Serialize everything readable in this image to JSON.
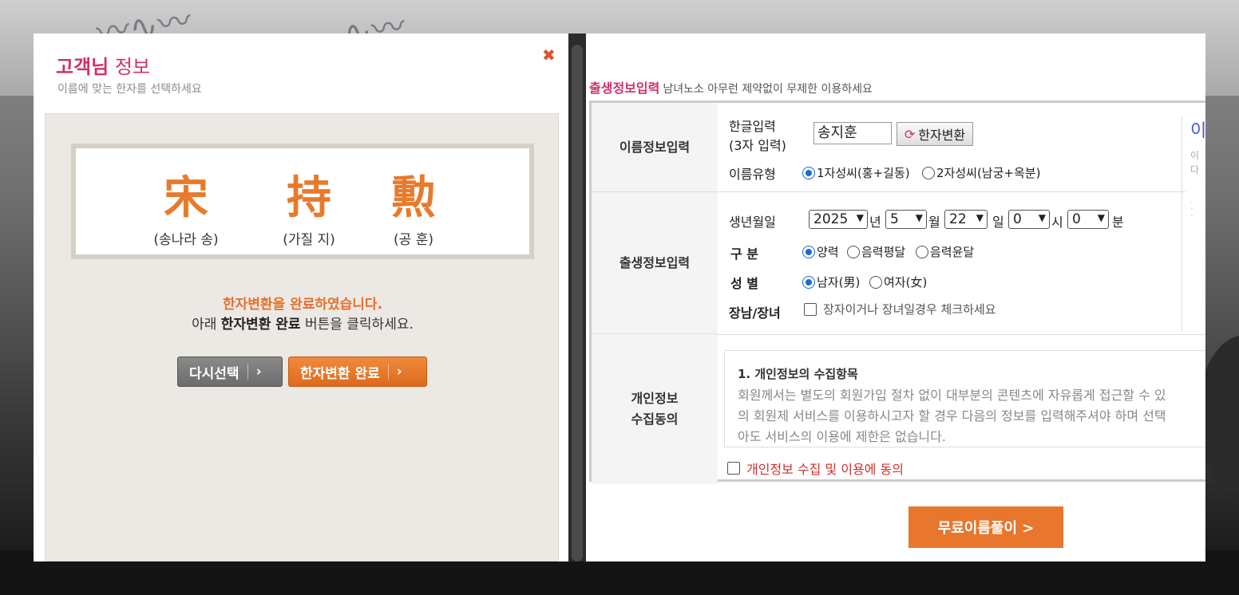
{
  "left_modal": {
    "title_bold": "고객님",
    "title_rest": " 정보",
    "subtitle": "이름에 맞는 한자를 선택하세요",
    "close_icon": "close-icon",
    "hanja": [
      {
        "char": "宋",
        "reading": "(송나라 송)"
      },
      {
        "char": "持",
        "reading": "(가질 지)"
      },
      {
        "char": "勲",
        "reading": "(공 훈)"
      }
    ],
    "message_done": "한자변환을 완료하였습니다.",
    "message_prefix": "아래 ",
    "message_bold": "한자변환 완료",
    "message_suffix": " 버튼을 클릭하세요.",
    "reselect_label": "다시선택",
    "complete_label": "한자변환 완료",
    "arrow": "›"
  },
  "right_page": {
    "header_title": "출생정보입력",
    "header_sub": "남녀노소 아무런 제약없이 무제한 이용하세요",
    "name_section": {
      "label": "이름정보입력",
      "korean_input_label_1": "한글입력",
      "korean_input_label_2": "(3자 입력)",
      "name_value": "송지훈",
      "hanja_button": "한자변환",
      "name_type_label": "이름유형",
      "name_type_opt1": "1자성씨(홍+길동)",
      "name_type_opt2": "2자성씨(남궁+옥분)"
    },
    "birth_section": {
      "label": "출생정보입력",
      "birthdate_label": "생년월일",
      "year": "2025",
      "year_unit": "년",
      "month": "5",
      "month_unit": "월",
      "day": "22",
      "day_unit": "일",
      "hour": "0",
      "hour_unit": "시",
      "minute": "0",
      "minute_unit": "분",
      "calendar_label": "구 분",
      "cal_opt1": "양력",
      "cal_opt2": "음력평달",
      "cal_opt3": "음력윤달",
      "gender_label": "성 별",
      "gender_opt1": "남자(男)",
      "gender_opt2": "여자(女)",
      "eldest_label": "장남/장녀",
      "eldest_check": "장자이거나 장녀일경우 체크하세요"
    },
    "privacy_section": {
      "label_1": "개인정보",
      "label_2": "수집동의",
      "terms_heading": "1. 개인정보의 수집항목",
      "terms_line1": "회원께서는 별도의 회원가입 절차 없이 대부분의 콘텐츠에 자유롭게 접근할 수 있",
      "terms_line2": "의 회원제 서비스를 이용하시고자 할 경우 다음의 정보를 입력해주셔야 하며 선택",
      "terms_line3": "아도 서비스의 이용에 제한은 없습니다.",
      "agree_label": "개인정보 수집 및 이용에 동의"
    },
    "side_fragment": {
      "big": "이",
      "small1": "이",
      "small2": "다"
    },
    "free_button": "무료이름풀이 >"
  },
  "colors": {
    "accent_pink": "#d0306c",
    "accent_orange": "#e8762c",
    "radio_blue": "#1d6ad7"
  }
}
